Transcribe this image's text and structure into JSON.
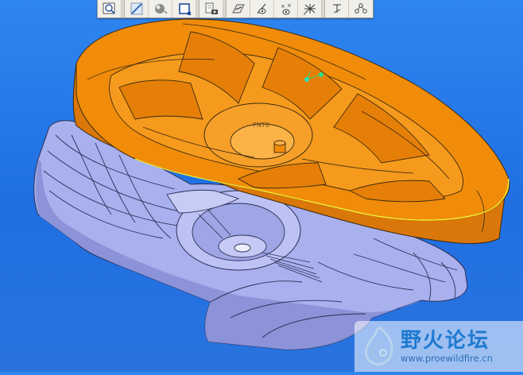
{
  "app": {
    "background_top": "#2f86f0",
    "background_bottom": "#2a73de"
  },
  "toolbar": {
    "buttons": [
      {
        "name": "zoom-window-icon",
        "label": ""
      },
      {
        "name": "sketch-line-icon",
        "label": ""
      },
      {
        "name": "shading-sphere-icon",
        "label": ""
      },
      {
        "name": "view-box-icon",
        "label": ""
      },
      {
        "name": "save-copy-camera-icon",
        "label": ""
      },
      {
        "name": "datum-plane-icon",
        "label": ""
      },
      {
        "name": "datum-axis-icon",
        "label": ""
      },
      {
        "name": "datum-point-icon",
        "label": ""
      },
      {
        "name": "coordinate-system-icon",
        "label": ""
      },
      {
        "name": "annotation-icon",
        "label": ""
      },
      {
        "name": "spin-center-icon",
        "label": ""
      }
    ]
  },
  "model": {
    "top_part_color": "#f08c0a",
    "bottom_part_color": "#a9b0ee",
    "edge_color": "#3c2a10",
    "highlight_edge_color": "#f4ff3a",
    "datum_tag": "PNT0"
  },
  "watermark": {
    "title": "野火论坛",
    "url": "www.proewildfire.cn"
  }
}
